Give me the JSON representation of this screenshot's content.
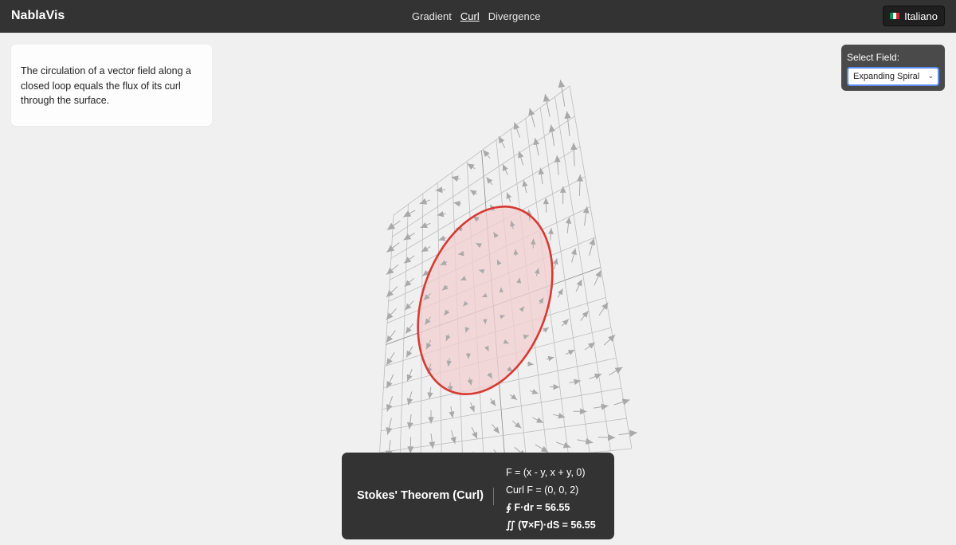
{
  "app": {
    "title": "NablaVis"
  },
  "nav": {
    "items": [
      {
        "label": "Gradient",
        "active": false
      },
      {
        "label": "Curl",
        "active": true
      },
      {
        "label": "Divergence",
        "active": false
      }
    ]
  },
  "language": {
    "label": "Italiano",
    "flag_colors": [
      "#009246",
      "#ffffff",
      "#ce2b37"
    ]
  },
  "info": {
    "text": "The circulation of a vector field along a closed loop equals the flux of its curl through the surface."
  },
  "field_select": {
    "label": "Select Field:",
    "selected": "Expanding Spiral"
  },
  "stokes": {
    "title": "Stokes' Theorem (Curl)",
    "field_eq": "F = (x - y, x + y, 0)",
    "curl_eq": "Curl F = (0, 0, 2)",
    "line_integral": "∮ F·dr = 56.55",
    "surface_integral": "∬ (∇×F)·dS = 56.55"
  },
  "colors": {
    "topbar": "#333333",
    "loop": "#d63a32",
    "loop_fill": "#f2cfcf",
    "grid": "#bdbdbd",
    "arrow": "#a9a9a9",
    "panel": "#333333"
  }
}
